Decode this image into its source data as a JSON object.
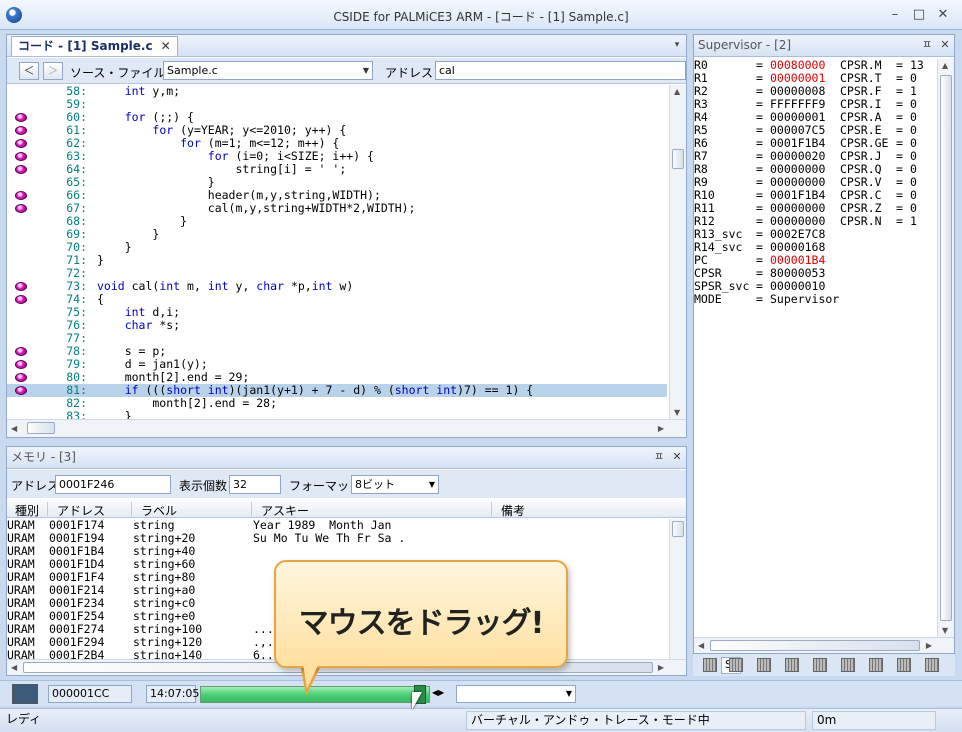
{
  "window": {
    "title": "CSIDE for PALMiCE3 ARM - [コード - [1] Sample.c]",
    "min": "–",
    "max": "□",
    "close": "✕"
  },
  "code_panel": {
    "tab_label": "コード - [1] Sample.c",
    "tab_close": "✕",
    "menu_arrow": "▾",
    "back": "＜",
    "forward": "＞",
    "source_label": "ソース・ファイル",
    "source_value": "Sample.c",
    "address_label": "アドレス",
    "address_value": "cal",
    "lines": [
      {
        "n": "58:",
        "bp": false,
        "cur": false,
        "src": [
          [
            "    ",
            ""
          ],
          [
            "int",
            "kw"
          ],
          [
            " y,m;",
            ""
          ]
        ]
      },
      {
        "n": "59:",
        "bp": false,
        "cur": false,
        "src": [
          [
            "",
            ""
          ]
        ]
      },
      {
        "n": "60:",
        "bp": true,
        "cur": false,
        "src": [
          [
            "    ",
            ""
          ],
          [
            "for",
            "kw"
          ],
          [
            " (;;) {",
            ""
          ]
        ]
      },
      {
        "n": "61:",
        "bp": true,
        "cur": false,
        "src": [
          [
            "        ",
            ""
          ],
          [
            "for",
            "kw"
          ],
          [
            " (y=YEAR; y<=2010; y++) {",
            ""
          ]
        ]
      },
      {
        "n": "62:",
        "bp": true,
        "cur": false,
        "src": [
          [
            "            ",
            ""
          ],
          [
            "for",
            "kw"
          ],
          [
            " (m=1; m<=12; m++) {",
            ""
          ]
        ]
      },
      {
        "n": "63:",
        "bp": true,
        "cur": false,
        "src": [
          [
            "                ",
            ""
          ],
          [
            "for",
            "kw"
          ],
          [
            " (i=0; i<SIZE; i++) {",
            ""
          ]
        ]
      },
      {
        "n": "64:",
        "bp": true,
        "cur": false,
        "src": [
          [
            "                    string[i] = ' ';",
            ""
          ]
        ]
      },
      {
        "n": "65:",
        "bp": false,
        "cur": false,
        "src": [
          [
            "                }",
            ""
          ]
        ]
      },
      {
        "n": "66:",
        "bp": true,
        "cur": false,
        "src": [
          [
            "                header(m,y,string,WIDTH);",
            ""
          ]
        ]
      },
      {
        "n": "67:",
        "bp": true,
        "cur": false,
        "src": [
          [
            "                cal(m,y,string+WIDTH*2,WIDTH);",
            ""
          ]
        ]
      },
      {
        "n": "68:",
        "bp": false,
        "cur": false,
        "src": [
          [
            "            }",
            ""
          ]
        ]
      },
      {
        "n": "69:",
        "bp": false,
        "cur": false,
        "src": [
          [
            "        }",
            ""
          ]
        ]
      },
      {
        "n": "70:",
        "bp": false,
        "cur": false,
        "src": [
          [
            "    }",
            ""
          ]
        ]
      },
      {
        "n": "71:",
        "bp": false,
        "cur": false,
        "src": [
          [
            "}",
            ""
          ]
        ]
      },
      {
        "n": "72:",
        "bp": false,
        "cur": false,
        "src": [
          [
            "",
            ""
          ]
        ]
      },
      {
        "n": "73:",
        "bp": true,
        "cur": false,
        "src": [
          [
            "void",
            "kw"
          ],
          [
            " cal(",
            ""
          ],
          [
            "int",
            "kw"
          ],
          [
            " m, ",
            ""
          ],
          [
            "int",
            "kw"
          ],
          [
            " y, ",
            ""
          ],
          [
            "char",
            "kw"
          ],
          [
            " *p,",
            ""
          ],
          [
            "int",
            "kw"
          ],
          [
            " w)",
            ""
          ]
        ]
      },
      {
        "n": "74:",
        "bp": true,
        "cur": false,
        "src": [
          [
            "{",
            ""
          ]
        ]
      },
      {
        "n": "75:",
        "bp": false,
        "cur": false,
        "src": [
          [
            "    ",
            ""
          ],
          [
            "int",
            "kw"
          ],
          [
            " d,i;",
            ""
          ]
        ]
      },
      {
        "n": "76:",
        "bp": false,
        "cur": false,
        "src": [
          [
            "    ",
            ""
          ],
          [
            "char",
            "kw"
          ],
          [
            " *s;",
            ""
          ]
        ]
      },
      {
        "n": "77:",
        "bp": false,
        "cur": false,
        "src": [
          [
            "",
            ""
          ]
        ]
      },
      {
        "n": "78:",
        "bp": true,
        "cur": false,
        "src": [
          [
            "    s = p;",
            ""
          ]
        ]
      },
      {
        "n": "79:",
        "bp": true,
        "cur": false,
        "src": [
          [
            "    d = jan1(y);",
            ""
          ]
        ]
      },
      {
        "n": "80:",
        "bp": true,
        "cur": false,
        "src": [
          [
            "    month[2].end = 29;",
            ""
          ]
        ]
      },
      {
        "n": "81:",
        "bp": true,
        "cur": true,
        "src": [
          [
            "    ",
            ""
          ],
          [
            "if",
            "kw"
          ],
          [
            " (((",
            ""
          ],
          [
            "short int",
            "kw"
          ],
          [
            ")(jan1(y+1) + 7 - d) % (",
            ""
          ],
          [
            "short int",
            "kw"
          ],
          [
            ")7) == 1) {",
            ""
          ]
        ]
      },
      {
        "n": "82:",
        "bp": false,
        "cur": false,
        "src": [
          [
            "        month[2].end = 28;",
            ""
          ]
        ]
      },
      {
        "n": "83:",
        "bp": false,
        "cur": false,
        "src": [
          [
            "    }",
            ""
          ]
        ]
      }
    ]
  },
  "memory_panel": {
    "title": "メモリ - [3]",
    "pin": "ㅍ",
    "close": "✕",
    "address_label": "アドレス",
    "address_value": "0001F246",
    "count_label": "表示個数",
    "count_value": "32",
    "format_label": "フォーマット",
    "format_value": "8ビット",
    "columns": [
      "種別",
      "アドレス",
      "ラベル",
      "アスキー",
      "備考"
    ],
    "rows": [
      [
        "URAM",
        "0001F174",
        "string",
        "Year 1989  Month Jan"
      ],
      [
        "URAM",
        "0001F194",
        "string+20",
        "Su Mo Tu We Th Fr Sa ."
      ],
      [
        "URAM",
        "0001F1B4",
        "string+40",
        ""
      ],
      [
        "URAM",
        "0001F1D4",
        "string+60",
        ""
      ],
      [
        "URAM",
        "0001F1F4",
        "string+80",
        ""
      ],
      [
        "URAM",
        "0001F214",
        "string+a0",
        ""
      ],
      [
        "URAM",
        "0001F234",
        "string+c0",
        ""
      ],
      [
        "URAM",
        "0001F254",
        "string+e0",
        ""
      ],
      [
        "URAM",
        "0001F274",
        "string+100",
        "..."
      ],
      [
        "URAM",
        "0001F294",
        "string+120",
        ".,."
      ],
      [
        "URAM",
        "0001F2B4",
        "string+140",
        "6.."
      ]
    ]
  },
  "supervisor_panel": {
    "title": "Supervisor - [2]",
    "pin": "ㅍ",
    "close": "✕",
    "registers": [
      {
        "name": "R0",
        "value": "00080000",
        "red": true,
        "flag": "CPSR.M",
        "fval": "13"
      },
      {
        "name": "R1",
        "value": "00000001",
        "red": true,
        "flag": "CPSR.T",
        "fval": "0"
      },
      {
        "name": "R2",
        "value": "00000008",
        "red": false,
        "flag": "CPSR.F",
        "fval": "1"
      },
      {
        "name": "R3",
        "value": "FFFFFFF9",
        "red": false,
        "flag": "CPSR.I",
        "fval": "0"
      },
      {
        "name": "R4",
        "value": "00000001",
        "red": false,
        "flag": "CPSR.A",
        "fval": "0"
      },
      {
        "name": "R5",
        "value": "000007C5",
        "red": false,
        "flag": "CPSR.E",
        "fval": "0"
      },
      {
        "name": "R6",
        "value": "0001F1B4",
        "red": false,
        "flag": "CPSR.GE",
        "fval": "0"
      },
      {
        "name": "R7",
        "value": "00000020",
        "red": false,
        "flag": "CPSR.J",
        "fval": "0"
      },
      {
        "name": "R8",
        "value": "00000000",
        "red": false,
        "flag": "CPSR.Q",
        "fval": "0"
      },
      {
        "name": "R9",
        "value": "00000000",
        "red": false,
        "flag": "CPSR.V",
        "fval": "0"
      },
      {
        "name": "R10",
        "value": "0001F1B4",
        "red": false,
        "flag": "CPSR.C",
        "fval": "0"
      },
      {
        "name": "R11",
        "value": "00000000",
        "red": false,
        "flag": "CPSR.Z",
        "fval": "0"
      },
      {
        "name": "R12",
        "value": "00000000",
        "red": false,
        "flag": "CPSR.N",
        "fval": "1"
      },
      {
        "name": "R13_svc",
        "value": "0002E7C8",
        "red": false,
        "flag": "",
        "fval": ""
      },
      {
        "name": "R14_svc",
        "value": "00000168",
        "red": false,
        "flag": "",
        "fval": ""
      },
      {
        "name": "PC",
        "value": "000001B4",
        "red": true,
        "flag": "",
        "fval": ""
      },
      {
        "name": "CPSR",
        "value": "80000053",
        "red": false,
        "flag": "",
        "fval": ""
      },
      {
        "name": "SPSR_svc",
        "value": "00000010",
        "red": false,
        "flag": "",
        "fval": ""
      },
      {
        "name": "MODE",
        "value": "Supervisor",
        "red": false,
        "flag": "",
        "fval": ""
      }
    ]
  },
  "icon_strip": {
    "first_label": "S"
  },
  "bottom_bar": {
    "address": "000001CC",
    "time": "14:07:05",
    "progress": 1.0,
    "combo_value": ""
  },
  "callout": {
    "text": "マウスをドラッグ!"
  },
  "status_bar": {
    "left": "レディ",
    "mode": "バーチャル・アンドゥ・トレース・モード中",
    "time": "0m"
  },
  "colors": {
    "accent": "#e8a440",
    "progress": "#4fcf78",
    "keyword": "#0000c8",
    "line_number": "#008080",
    "register_changed": "#e00000"
  }
}
